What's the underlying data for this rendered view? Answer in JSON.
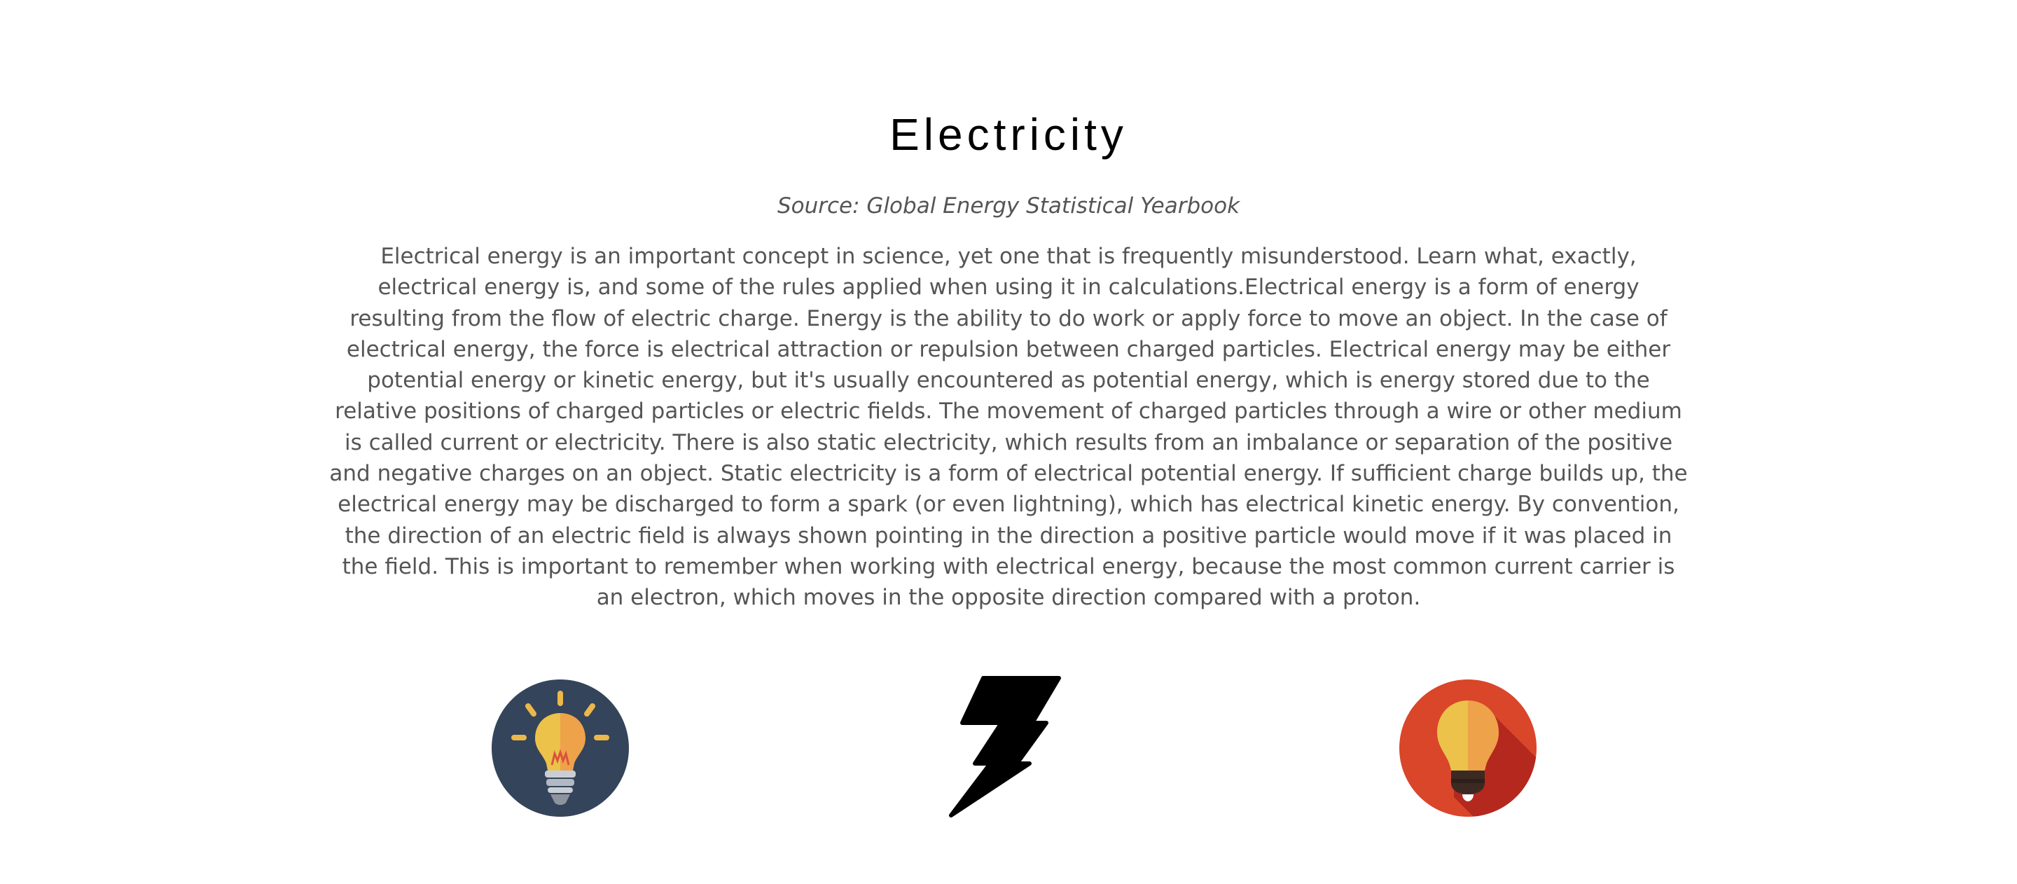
{
  "title": "Electricity",
  "source": "Source: Global Energy Statistical Yearbook",
  "body": "Electrical energy is an important concept in science, yet one that is frequently misunderstood. Learn what, exactly, electrical energy is, and some of the rules applied when using it in calculations.Electrical energy is a form of energy resulting from the flow of electric charge. Energy is the ability to do work or apply force to move an object. In the case of electrical energy, the force is electrical attraction or repulsion between charged particles. Electrical energy may be either potential energy or kinetic energy, but it's usually encountered as potential energy, which is energy stored due to the relative positions of charged particles or electric fields. The movement of charged particles through a wire or other medium is called current or electricity. There is also static electricity, which results from an imbalance or separation of the positive and negative charges on an object. Static electricity is a form of electrical potential energy. If sufficient charge builds up, the electrical energy may be discharged to form a spark (or even lightning), which has electrical kinetic energy. By convention, the direction of an electric field is always shown pointing in the direction a positive particle would move if it was placed in the field. This is important to remember when working with electrical energy, because the most common current carrier is an electron, which moves in the opposite direction compared with a proton.",
  "icons": [
    {
      "name": "light-bulb-dark-circle-icon",
      "bg": "#34445a"
    },
    {
      "name": "lightning-bolt-icon",
      "color": "#000000"
    },
    {
      "name": "light-bulb-red-circle-icon",
      "bg": "#d9462a"
    }
  ],
  "colors": {
    "text": "#555555",
    "title": "#000000",
    "bulb_yellow": "#ecc24a",
    "bulb_orange": "#eea24a"
  }
}
